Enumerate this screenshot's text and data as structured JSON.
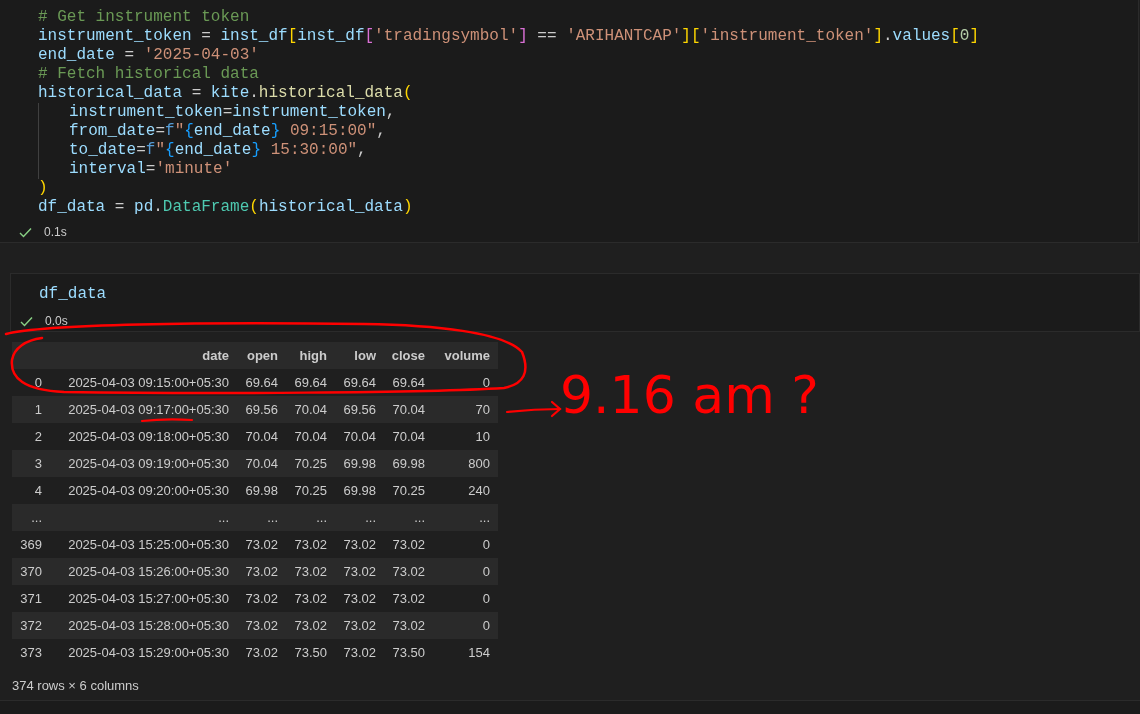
{
  "cells": [
    {
      "code": [
        {
          "indent": false,
          "tokens": [
            {
              "kind": "c",
              "text": "# Get instrument token"
            }
          ]
        },
        {
          "indent": false,
          "tokens": [
            {
              "kind": "v",
              "text": "instrument_token"
            },
            {
              "kind": "p",
              "text": " = "
            },
            {
              "kind": "v",
              "text": "inst_df"
            },
            {
              "kind": "b1",
              "text": "["
            },
            {
              "kind": "v",
              "text": "inst_df"
            },
            {
              "kind": "b2",
              "text": "["
            },
            {
              "kind": "s",
              "text": "'tradingsymbol'"
            },
            {
              "kind": "b2",
              "text": "]"
            },
            {
              "kind": "p",
              "text": " == "
            },
            {
              "kind": "s",
              "text": "'ARIHANTCAP'"
            },
            {
              "kind": "b1",
              "text": "]["
            },
            {
              "kind": "s",
              "text": "'instrument_token'"
            },
            {
              "kind": "b1",
              "text": "]"
            },
            {
              "kind": "p",
              "text": "."
            },
            {
              "kind": "v",
              "text": "values"
            },
            {
              "kind": "b1",
              "text": "["
            },
            {
              "kind": "n",
              "text": "0"
            },
            {
              "kind": "b1",
              "text": "]"
            }
          ]
        },
        {
          "indent": false,
          "tokens": [
            {
              "kind": "v",
              "text": "end_date"
            },
            {
              "kind": "p",
              "text": " = "
            },
            {
              "kind": "s",
              "text": "'2025-04-03'"
            }
          ]
        },
        {
          "indent": false,
          "tokens": [
            {
              "kind": "c",
              "text": "# Fetch historical data"
            }
          ]
        },
        {
          "indent": false,
          "tokens": [
            {
              "kind": "v",
              "text": "historical_data"
            },
            {
              "kind": "p",
              "text": " = "
            },
            {
              "kind": "v",
              "text": "kite"
            },
            {
              "kind": "p",
              "text": "."
            },
            {
              "kind": "f",
              "text": "historical_data"
            },
            {
              "kind": "b1",
              "text": "("
            }
          ]
        },
        {
          "indent": true,
          "tokens": [
            {
              "kind": "v",
              "text": "instrument_token"
            },
            {
              "kind": "p",
              "text": "="
            },
            {
              "kind": "v",
              "text": "instrument_token"
            },
            {
              "kind": "p",
              "text": ","
            }
          ]
        },
        {
          "indent": true,
          "tokens": [
            {
              "kind": "v",
              "text": "from_date"
            },
            {
              "kind": "p",
              "text": "="
            },
            {
              "kind": "k",
              "text": "f"
            },
            {
              "kind": "s",
              "text": "\""
            },
            {
              "kind": "b3",
              "text": "{"
            },
            {
              "kind": "v",
              "text": "end_date"
            },
            {
              "kind": "b3",
              "text": "}"
            },
            {
              "kind": "s",
              "text": " 09:15:00\""
            },
            {
              "kind": "p",
              "text": ","
            }
          ]
        },
        {
          "indent": true,
          "tokens": [
            {
              "kind": "v",
              "text": "to_date"
            },
            {
              "kind": "p",
              "text": "="
            },
            {
              "kind": "k",
              "text": "f"
            },
            {
              "kind": "s",
              "text": "\""
            },
            {
              "kind": "b3",
              "text": "{"
            },
            {
              "kind": "v",
              "text": "end_date"
            },
            {
              "kind": "b3",
              "text": "}"
            },
            {
              "kind": "s",
              "text": " 15:30:00\""
            },
            {
              "kind": "p",
              "text": ","
            }
          ]
        },
        {
          "indent": true,
          "tokens": [
            {
              "kind": "v",
              "text": "interval"
            },
            {
              "kind": "p",
              "text": "="
            },
            {
              "kind": "s",
              "text": "'minute'"
            }
          ]
        },
        {
          "indent": false,
          "tokens": [
            {
              "kind": "b1",
              "text": ")"
            }
          ]
        },
        {
          "indent": false,
          "tokens": [
            {
              "kind": "v",
              "text": "df_data"
            },
            {
              "kind": "p",
              "text": " = "
            },
            {
              "kind": "v",
              "text": "pd"
            },
            {
              "kind": "p",
              "text": "."
            },
            {
              "kind": "t",
              "text": "DataFrame"
            },
            {
              "kind": "b1",
              "text": "("
            },
            {
              "kind": "v",
              "text": "historical_data"
            },
            {
              "kind": "b1",
              "text": ")"
            }
          ]
        }
      ],
      "status": {
        "time": "0.1s"
      }
    },
    {
      "code": [
        {
          "indent": false,
          "tokens": [
            {
              "kind": "v",
              "text": "df_data"
            }
          ]
        }
      ],
      "status": {
        "time": "0.0s"
      }
    }
  ],
  "output": {
    "table": {
      "columns": [
        "date",
        "open",
        "high",
        "low",
        "close",
        "volume"
      ],
      "rows": [
        {
          "index": "0",
          "cells": [
            "2025-04-03 09:15:00+05:30",
            "69.64",
            "69.64",
            "69.64",
            "69.64",
            "0"
          ]
        },
        {
          "index": "1",
          "cells": [
            "2025-04-03 09:17:00+05:30",
            "69.56",
            "70.04",
            "69.56",
            "70.04",
            "70"
          ]
        },
        {
          "index": "2",
          "cells": [
            "2025-04-03 09:18:00+05:30",
            "70.04",
            "70.04",
            "70.04",
            "70.04",
            "10"
          ]
        },
        {
          "index": "3",
          "cells": [
            "2025-04-03 09:19:00+05:30",
            "70.04",
            "70.25",
            "69.98",
            "69.98",
            "800"
          ]
        },
        {
          "index": "4",
          "cells": [
            "2025-04-03 09:20:00+05:30",
            "69.98",
            "70.25",
            "69.98",
            "70.25",
            "240"
          ]
        },
        {
          "index": "...",
          "cells": [
            "...",
            "...",
            "...",
            "...",
            "...",
            "..."
          ]
        },
        {
          "index": "369",
          "cells": [
            "2025-04-03 15:25:00+05:30",
            "73.02",
            "73.02",
            "73.02",
            "73.02",
            "0"
          ]
        },
        {
          "index": "370",
          "cells": [
            "2025-04-03 15:26:00+05:30",
            "73.02",
            "73.02",
            "73.02",
            "73.02",
            "0"
          ]
        },
        {
          "index": "371",
          "cells": [
            "2025-04-03 15:27:00+05:30",
            "73.02",
            "73.02",
            "73.02",
            "73.02",
            "0"
          ]
        },
        {
          "index": "372",
          "cells": [
            "2025-04-03 15:28:00+05:30",
            "73.02",
            "73.02",
            "73.02",
            "73.02",
            "0"
          ]
        },
        {
          "index": "373",
          "cells": [
            "2025-04-03 15:29:00+05:30",
            "73.02",
            "73.50",
            "73.02",
            "73.50",
            "154"
          ]
        }
      ]
    },
    "summary": "374 rows × 6 columns"
  },
  "annotation": {
    "text": "9.16 am ?"
  }
}
